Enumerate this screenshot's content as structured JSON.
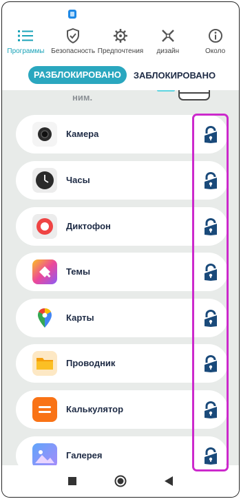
{
  "tabs": [
    {
      "label": "Программы",
      "icon": "list-icon",
      "active": true
    },
    {
      "label": "Безопасность",
      "icon": "shield-check-icon",
      "active": false
    },
    {
      "label": "Предпочтения",
      "icon": "gear-icon",
      "active": false
    },
    {
      "label": "дизайн",
      "icon": "brush-icon",
      "active": false
    },
    {
      "label": "Около",
      "icon": "info-icon",
      "active": false
    }
  ],
  "segment": {
    "unlocked": "РАЗБЛОКИРОВАНО",
    "locked": "ЗАБЛОКИРОВАНО"
  },
  "partial_text": "ним.",
  "apps": [
    {
      "name": "Камера",
      "icon": "camera-icon"
    },
    {
      "name": "Часы",
      "icon": "clock-icon"
    },
    {
      "name": "Диктофон",
      "icon": "recorder-icon"
    },
    {
      "name": "Темы",
      "icon": "themes-icon"
    },
    {
      "name": "Карты",
      "icon": "maps-icon"
    },
    {
      "name": "Проводник",
      "icon": "folder-icon"
    },
    {
      "name": "Калькулятор",
      "icon": "calculator-icon"
    },
    {
      "name": "Галерея",
      "icon": "gallery-icon"
    }
  ],
  "colors": {
    "accent": "#2aa7bf",
    "lock": "#1a4a7a",
    "highlight": "#cc29cc",
    "text": "#1d2a44"
  }
}
